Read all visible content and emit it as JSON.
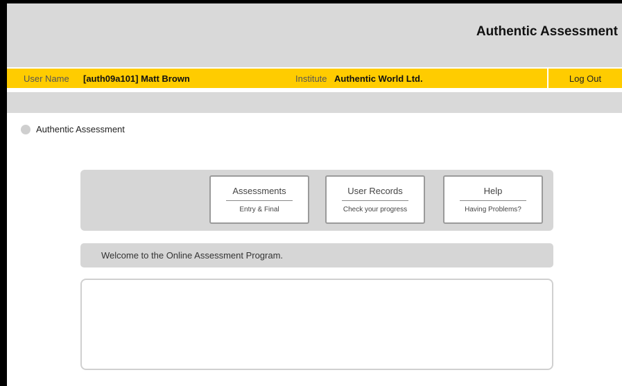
{
  "header": {
    "title": "Authentic Assessment"
  },
  "userbar": {
    "user_label": "User Name",
    "user_value": "[auth09a101]  Matt Brown",
    "institute_label": "Institute",
    "institute_value": "Authentic World Ltd.",
    "logout_label": "Log Out"
  },
  "breadcrumb": {
    "label": "Authentic Assessment"
  },
  "nav": [
    {
      "title": "Assessments",
      "subtitle": "Entry & Final"
    },
    {
      "title": "User Records",
      "subtitle": "Check your progress"
    },
    {
      "title": "Help",
      "subtitle": "Having Problems?"
    }
  ],
  "welcome": {
    "text": "Welcome to the Online Assessment Program."
  },
  "colors": {
    "accent": "#ffcc00",
    "panel": "#d6d6d6",
    "header": "#d9d9d9"
  }
}
